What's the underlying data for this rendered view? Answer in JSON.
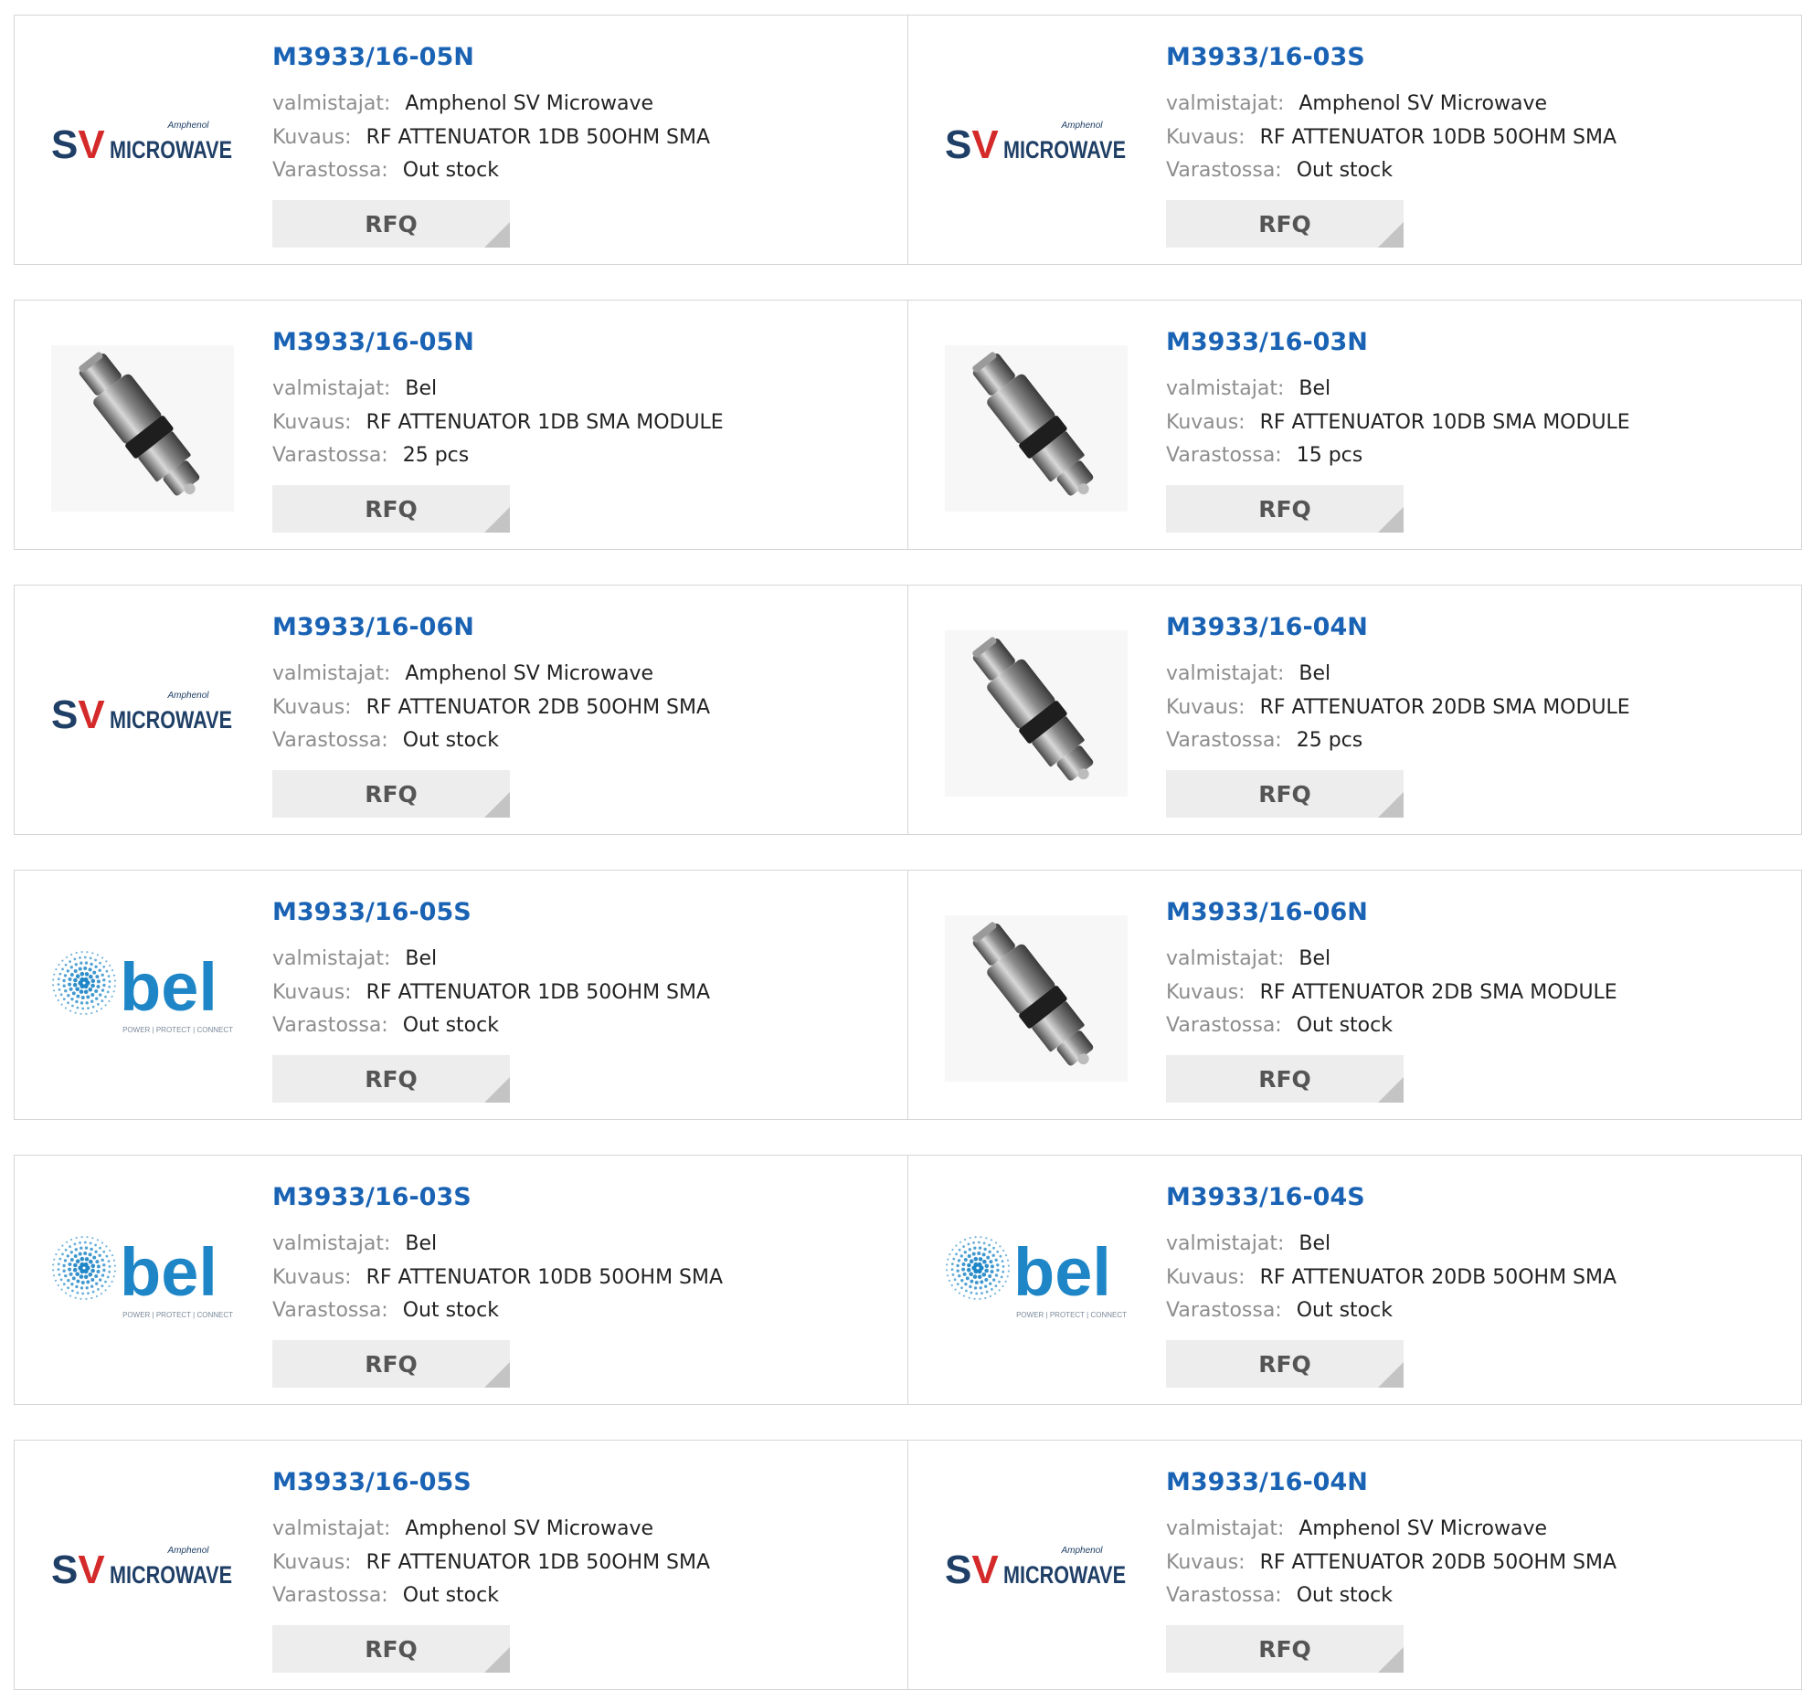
{
  "labels": {
    "manufacturer": "valmistajat:",
    "description": "Kuvaus:",
    "stock": "Varastossa:",
    "rfq": "RFQ"
  },
  "products": [
    [
      {
        "part": "M3933/16-05N",
        "manufacturer": "Amphenol SV Microwave",
        "description": "RF ATTENUATOR 1DB 50OHM SMA",
        "stock": "Out stock",
        "image": "sv-microwave-logo"
      },
      {
        "part": "M3933/16-03S",
        "manufacturer": "Amphenol SV Microwave",
        "description": "RF ATTENUATOR 10DB 50OHM SMA",
        "stock": "Out stock",
        "image": "sv-microwave-logo"
      }
    ],
    [
      {
        "part": "M3933/16-05N",
        "manufacturer": "Bel",
        "description": "RF ATTENUATOR 1DB SMA MODULE",
        "stock": "25 pcs",
        "image": "attenuator-photo"
      },
      {
        "part": "M3933/16-03N",
        "manufacturer": "Bel",
        "description": "RF ATTENUATOR 10DB SMA MODULE",
        "stock": "15 pcs",
        "image": "attenuator-photo"
      }
    ],
    [
      {
        "part": "M3933/16-06N",
        "manufacturer": "Amphenol SV Microwave",
        "description": "RF ATTENUATOR 2DB 50OHM SMA",
        "stock": "Out stock",
        "image": "sv-microwave-logo"
      },
      {
        "part": "M3933/16-04N",
        "manufacturer": "Bel",
        "description": "RF ATTENUATOR 20DB SMA MODULE",
        "stock": "25 pcs",
        "image": "attenuator-photo"
      }
    ],
    [
      {
        "part": "M3933/16-05S",
        "manufacturer": "Bel",
        "description": "RF ATTENUATOR 1DB 50OHM SMA",
        "stock": "Out stock",
        "image": "bel-logo"
      },
      {
        "part": "M3933/16-06N",
        "manufacturer": "Bel",
        "description": "RF ATTENUATOR 2DB SMA MODULE",
        "stock": "Out stock",
        "image": "attenuator-photo"
      }
    ],
    [
      {
        "part": "M3933/16-03S",
        "manufacturer": "Bel",
        "description": "RF ATTENUATOR 10DB 50OHM SMA",
        "stock": "Out stock",
        "image": "bel-logo"
      },
      {
        "part": "M3933/16-04S",
        "manufacturer": "Bel",
        "description": "RF ATTENUATOR 20DB 50OHM SMA",
        "stock": "Out stock",
        "image": "bel-logo"
      }
    ],
    [
      {
        "part": "M3933/16-05S",
        "manufacturer": "Amphenol SV Microwave",
        "description": "RF ATTENUATOR 1DB 50OHM SMA",
        "stock": "Out stock",
        "image": "sv-microwave-logo"
      },
      {
        "part": "M3933/16-04N",
        "manufacturer": "Amphenol SV Microwave",
        "description": "RF ATTENUATOR 20DB 50OHM SMA",
        "stock": "Out stock",
        "image": "sv-microwave-logo"
      }
    ]
  ],
  "logos": {
    "sv": {
      "mark": "SV",
      "word": "MICROWAVE",
      "tagline": "Amphenol",
      "color": "#1f3f66",
      "accent": "#d42a2a"
    },
    "bel": {
      "word": "bel",
      "tagline": "POWER | PROTECT | CONNECT",
      "color": "#1e86c6"
    }
  }
}
